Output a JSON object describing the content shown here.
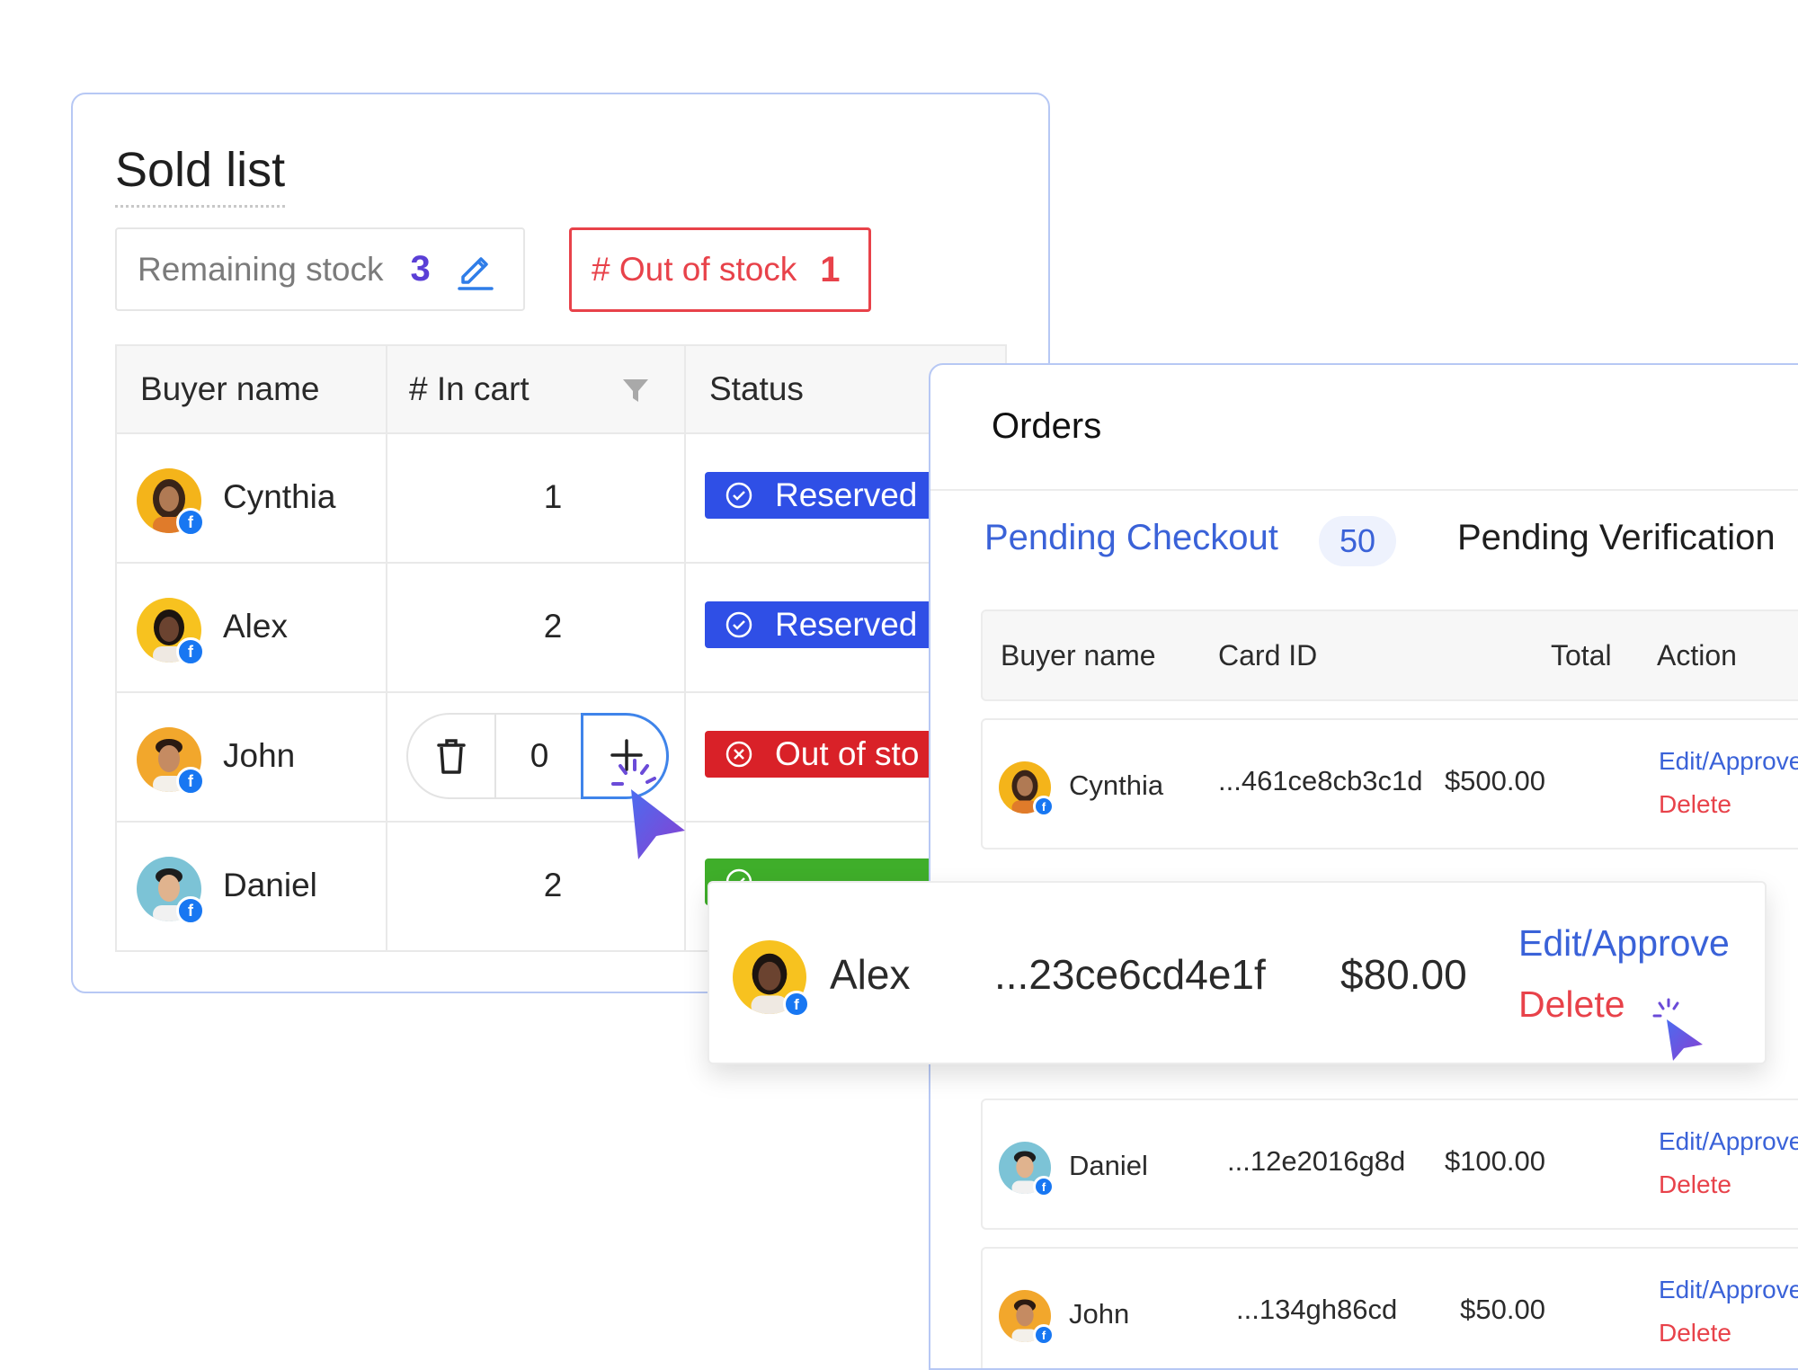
{
  "sold_list": {
    "title": "Sold list",
    "remaining_label": "Remaining stock",
    "remaining_count": "3",
    "out_of_stock_label": "# Out of stock",
    "out_of_stock_count": "1",
    "columns": [
      "Buyer name",
      "# In cart",
      "Status"
    ],
    "rows": [
      {
        "name": "Cynthia",
        "in_cart": "1",
        "status": "Reserved"
      },
      {
        "name": "Alex",
        "in_cart": "2",
        "status": "Reserved"
      },
      {
        "name": "John",
        "in_cart": "0",
        "status": "Out of sto"
      },
      {
        "name": "Daniel",
        "in_cart": "2",
        "status": ""
      }
    ]
  },
  "orders": {
    "title": "Orders",
    "tab_active": "Pending Checkout",
    "tab_active_count": "50",
    "tab_other": "Pending Verification",
    "columns": [
      "Buyer name",
      "Card ID",
      "Total",
      "Action"
    ],
    "edit_label": "Edit/Approve",
    "delete_label": "Delete",
    "rows": [
      {
        "name": "Cynthia",
        "card": "...461ce8cb3c1d",
        "total": "$500.00"
      },
      {
        "name": "Daniel",
        "card": "...12e2016g8d",
        "total": "$100.00"
      },
      {
        "name": "John",
        "card": "...134gh86cd",
        "total": "$50.00"
      }
    ],
    "highlight": {
      "name": "Alex",
      "card": "...23ce6cd4e1f",
      "total": "$80.00"
    }
  },
  "colors": {
    "accent_blue": "#3a62d8",
    "reserved": "#2f4fe6",
    "out_of_stock": "#d92128",
    "paid": "#3fae2a",
    "danger": "#e8424a",
    "remaining_count": "#5a3fd6"
  },
  "icons": [
    "edit-icon",
    "funnel-icon",
    "check-circle-icon",
    "x-circle-icon",
    "trash-icon",
    "plus-icon",
    "facebook-icon",
    "cursor-icon"
  ]
}
